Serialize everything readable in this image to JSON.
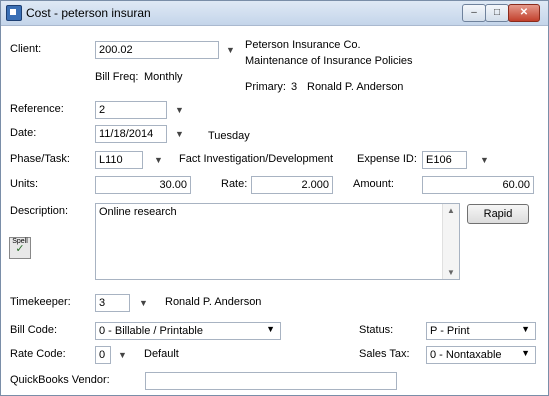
{
  "window": {
    "title": "Cost - peterson insuran",
    "min": "–",
    "max": "□",
    "close": "✕"
  },
  "client": {
    "label": "Client:",
    "value": "200.02",
    "name_line1": "Peterson Insurance Co.",
    "name_line2": "Maintenance of Insurance Policies"
  },
  "billfreq": {
    "label": "Bill Freq:",
    "value": "Monthly"
  },
  "primary": {
    "label": "Primary:",
    "number": "3",
    "name": "Ronald P. Anderson"
  },
  "reference": {
    "label": "Reference:",
    "value": "2"
  },
  "date": {
    "label": "Date:",
    "value": "11/18/2014",
    "weekday": "Tuesday"
  },
  "phase": {
    "label": "Phase/Task:",
    "value": "L110",
    "desc": "Fact Investigation/Development"
  },
  "expense": {
    "label": "Expense ID:",
    "value": "E106"
  },
  "units": {
    "label": "Units:",
    "value": "30.00"
  },
  "rate": {
    "label": "Rate:",
    "value": "2.000"
  },
  "amount": {
    "label": "Amount:",
    "value": "60.00"
  },
  "description": {
    "label": "Description:",
    "value": "Online research"
  },
  "rapid_button": "Rapid",
  "spell_button": "Spell",
  "timekeeper": {
    "label": "Timekeeper:",
    "value": "3",
    "name": "Ronald P. Anderson"
  },
  "billcode": {
    "label": "Bill Code:",
    "value": "0 - Billable / Printable"
  },
  "status": {
    "label": "Status:",
    "value": "P - Print"
  },
  "ratecode": {
    "label": "Rate Code:",
    "value": "0",
    "desc": "Default"
  },
  "salestax": {
    "label": "Sales Tax:",
    "value": "0 - Nontaxable"
  },
  "qbvendor": {
    "label": "QuickBooks Vendor:",
    "value": ""
  },
  "icons": {
    "dropdown": "▼",
    "scroll_up": "▲",
    "scroll_down": "▼"
  }
}
